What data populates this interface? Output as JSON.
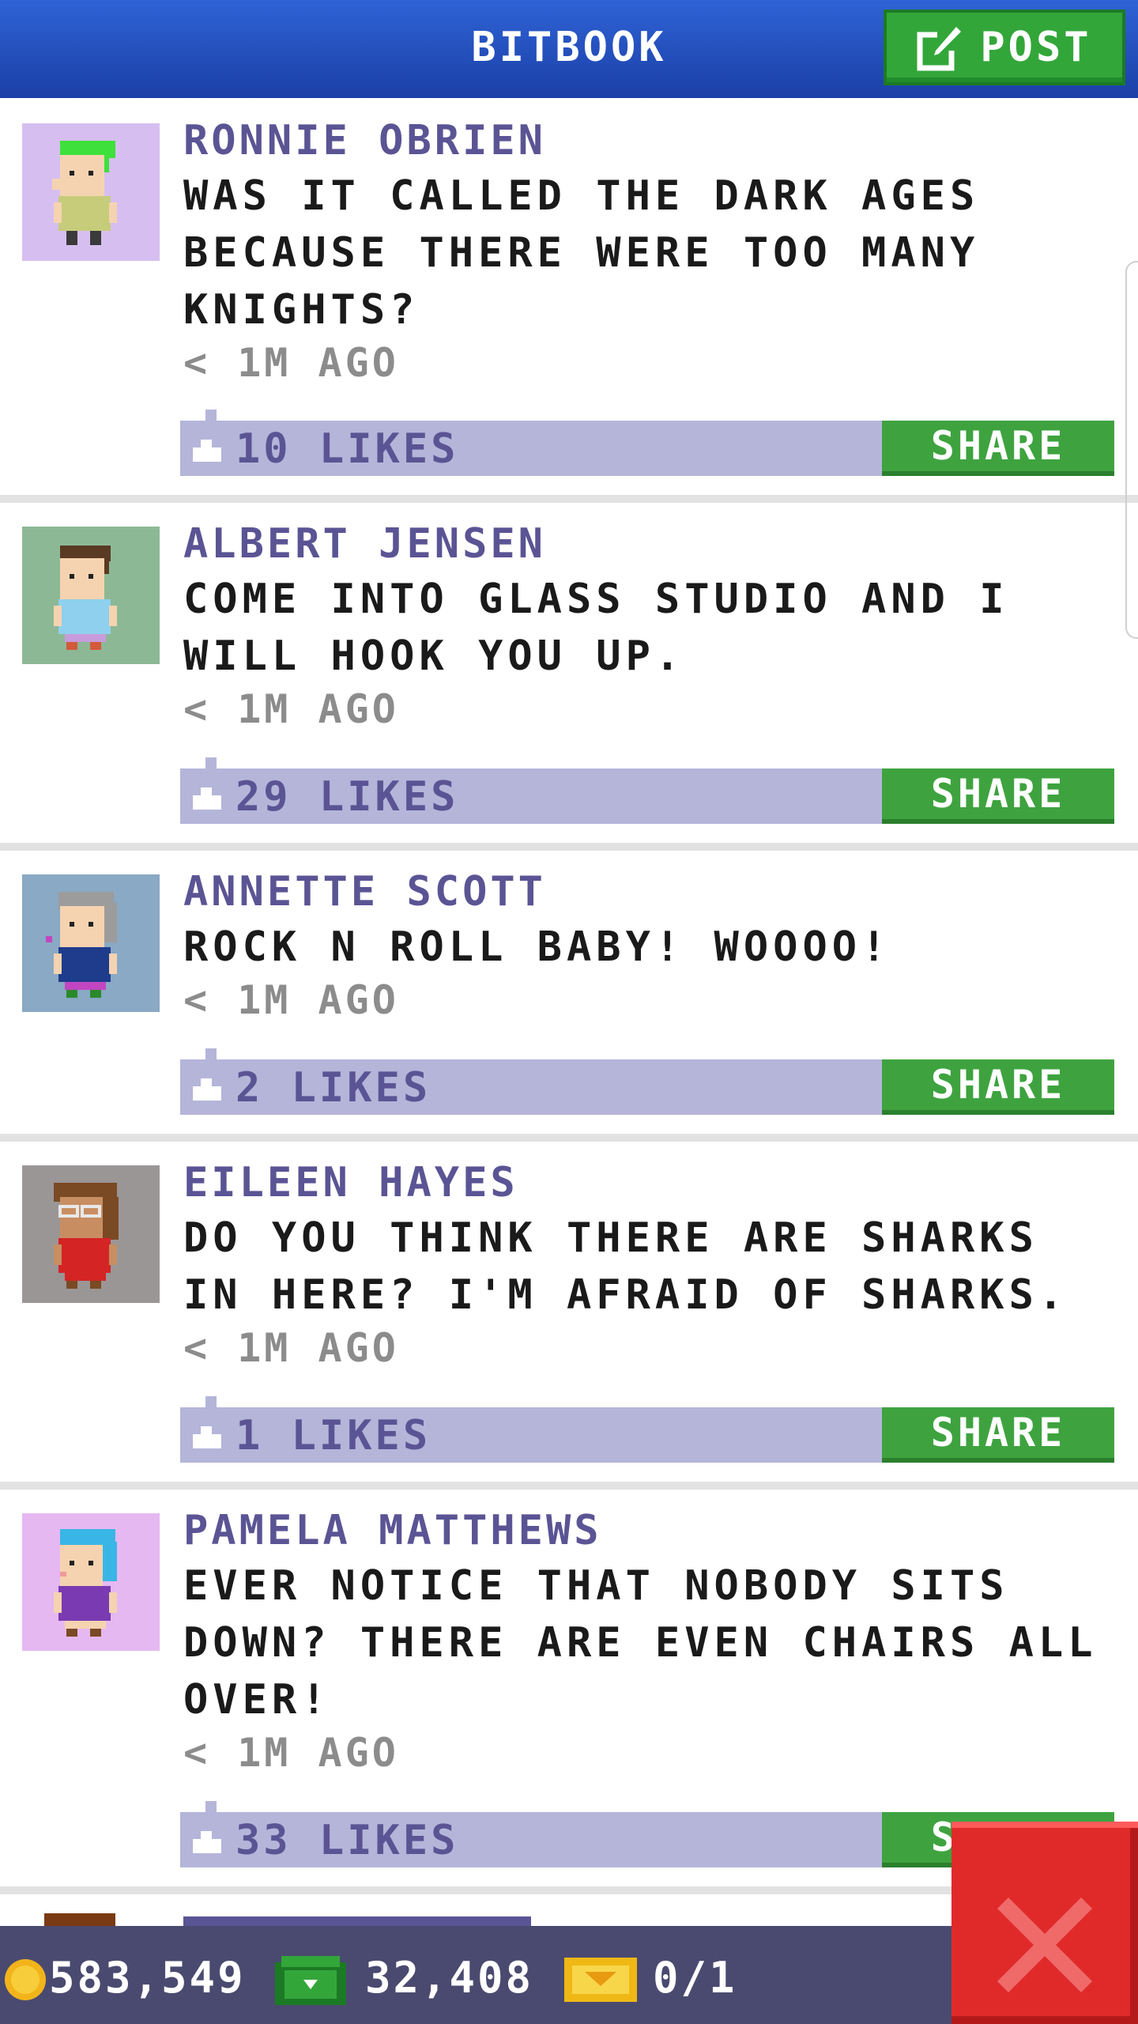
{
  "app": {
    "title": "BITBOOK",
    "post_label": "POST"
  },
  "colors": {
    "header_blue": "#2f63d6",
    "accent_green": "#33a63a",
    "likes_bar": "#b4b5d9",
    "name_purple": "#5b5494",
    "close_red": "#e02a2a"
  },
  "posts": [
    {
      "author": "RONNIE OBRIEN",
      "message": "WAS IT CALLED THE DARK AGES BECAUSE THERE WERE TOO MANY KNIGHTS?",
      "time": "< 1M AGO",
      "likes": "10 LIKES",
      "share": "SHARE",
      "avatar": {
        "bg": "#d6bff0",
        "hair": "#3ee03b",
        "shirt": "#c6cc7a",
        "pants": "#3a3a3a"
      }
    },
    {
      "author": "ALBERT JENSEN",
      "message": "COME INTO GLASS STUDIO AND I WILL HOOK YOU UP.",
      "time": "< 1M AGO",
      "likes": "29 LIKES",
      "share": "SHARE",
      "avatar": {
        "bg": "#8db896",
        "hair": "#5a3a22",
        "shirt": "#8ed0ee",
        "pants": "#c89cdc"
      }
    },
    {
      "author": "ANNETTE SCOTT",
      "message": "ROCK N ROLL BABY! WOOOO!",
      "time": "< 1M AGO",
      "likes": "2 LIKES",
      "share": "SHARE",
      "avatar": {
        "bg": "#89a9c4",
        "hair": "#9c9c9c",
        "shirt": "#1f3b8c",
        "pants": "#c246c2"
      }
    },
    {
      "author": "EILEEN HAYES",
      "message": "DO YOU THINK THERE ARE SHARKS IN HERE? I'M AFRAID OF SHARKS.",
      "time": "< 1M AGO",
      "likes": "1 LIKES",
      "share": "SHARE",
      "avatar": {
        "bg": "#9b9696",
        "hair": "#7a4a24",
        "shirt": "#d42424",
        "pants": "#3a3a3a"
      }
    },
    {
      "author": "PAMELA MATTHEWS",
      "message": "EVER NOTICE THAT NOBODY SITS DOWN? THERE ARE EVEN CHAIRS ALL OVER!",
      "time": "< 1M AGO",
      "likes": "33 LIKES",
      "share": "SHARE",
      "avatar": {
        "bg": "#e6b8f2",
        "hair": "#3ab6e6",
        "shirt": "#7a3ab2",
        "pants": "#3a3a3a"
      }
    }
  ],
  "status": {
    "coins": "583,549",
    "bux": "32,408",
    "tickets": "0/1"
  },
  "icons": {
    "post": "edit-icon",
    "like": "like-icon",
    "coin": "coin-icon",
    "bux": "cash-icon",
    "ticket": "ticket-icon",
    "close": "close-icon"
  }
}
